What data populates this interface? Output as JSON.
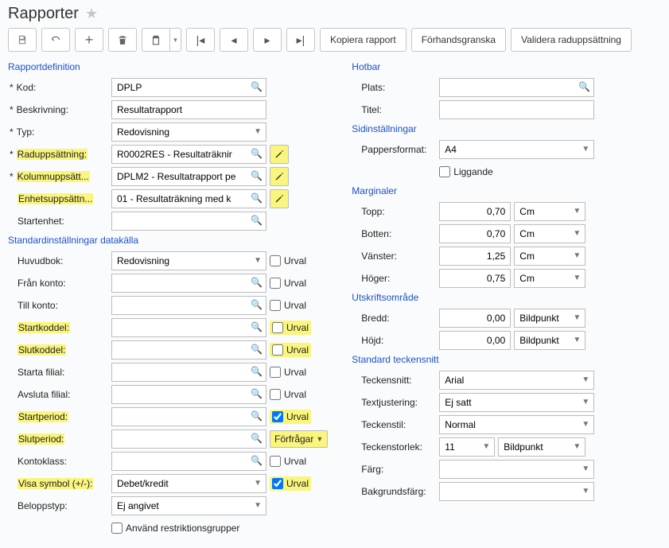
{
  "page": {
    "title": "Rapporter"
  },
  "toolbar": {
    "copy": "Kopiera rapport",
    "preview": "Förhandsgranska",
    "validate": "Validera raduppsättning"
  },
  "sections": {
    "rapportdef": "Rapportdefinition",
    "standard_datakalla": "Standardinställningar datakälla",
    "hotbar": "Hotbar",
    "sidinst": "Sidinställningar",
    "marginaler": "Marginaler",
    "utskrift": "Utskriftsområde",
    "font": "Standard teckensnitt"
  },
  "labels": {
    "kod": "Kod:",
    "beskrivning": "Beskrivning:",
    "typ": "Typ:",
    "radupps": "Raduppsättning:",
    "kolupps": "Kolumnuppsätt...",
    "enhupps": "Enhetsuppsättn...",
    "startenhet": "Startenhet:",
    "huvudbok": "Huvudbok:",
    "frankonto": "Från konto:",
    "tillkonto": "Till konto:",
    "startkoddel": "Startkoddel:",
    "slutkoddel": "Slutkoddel:",
    "startafilial": "Starta filial:",
    "avslutafilial": "Avsluta filial:",
    "startperiod": "Startperiod:",
    "slutperiod": "Slutperiod:",
    "kontoklass": "Kontoklass:",
    "visasymbol": "Visa symbol (+/-):",
    "beloppstyp": "Beloppstyp:",
    "restrikt": "Använd restriktionsgrupper",
    "plats": "Plats:",
    "titel": "Titel:",
    "pappersformat": "Pappersformat:",
    "liggande": "Liggande",
    "topp": "Topp:",
    "botten": "Botten:",
    "vanster": "Vänster:",
    "hoger": "Höger:",
    "bredd": "Bredd:",
    "hojd": "Höjd:",
    "teckensnitt": "Teckensnitt:",
    "textjust": "Textjustering:",
    "teckenstil": "Teckenstil:",
    "teckenstorlek": "Teckenstorlek:",
    "farg": "Färg:",
    "bakgrund": "Bakgrundsfärg:",
    "urval": "Urval",
    "forfragar": "Förfrågar"
  },
  "values": {
    "kod": "DPLP",
    "beskrivning": "Resultatrapport",
    "typ": "Redovisning",
    "radupps": "R0002RES - Resultaträknir",
    "kolupps": "DPLM2 - Resultatrapport pe",
    "enhupps": "01 - Resultaträkning med k",
    "huvudbok": "Redovisning",
    "visasymbol": "Debet/kredit",
    "beloppstyp": "Ej angivet",
    "pappersformat": "A4",
    "topp": "0,70",
    "botten": "0,70",
    "vanster": "1,25",
    "hoger": "0,75",
    "bredd": "0,00",
    "hojd": "0,00",
    "units_cm": "Cm",
    "units_bild": "Bildpunkt",
    "teckensnitt": "Arial",
    "textjust": "Ej satt",
    "teckenstil": "Normal",
    "teckenstorlek": "11",
    "teckenunit": "Bildpunkt"
  },
  "checks": {
    "huvudbok": false,
    "frankonto": false,
    "tillkonto": false,
    "startkoddel": false,
    "slutkoddel": false,
    "startafilial": false,
    "avslutafilial": false,
    "startperiod": true,
    "kontoklass": false,
    "visasymbol": true,
    "liggande": false,
    "restrikt": false
  }
}
